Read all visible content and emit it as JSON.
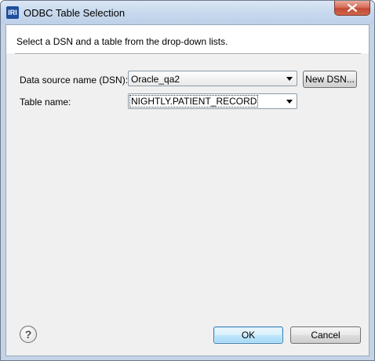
{
  "window": {
    "app_icon_text": "IRI",
    "title": "ODBC Table Selection"
  },
  "dialog": {
    "instruction": "Select a DSN and a table from the drop-down lists.",
    "dsn": {
      "label": "Data source name (DSN):",
      "selected": "Oracle_qa2",
      "new_button": "New DSN..."
    },
    "table": {
      "label": "Table name:",
      "selected": "NIGHTLY.PATIENT_RECORD"
    }
  },
  "footer": {
    "help_symbol": "?",
    "ok_label": "OK",
    "cancel_label": "Cancel"
  },
  "icons": {
    "app": "iri-logo-icon",
    "close": "close-icon",
    "dropdown": "chevron-down-icon",
    "help": "help-icon"
  }
}
